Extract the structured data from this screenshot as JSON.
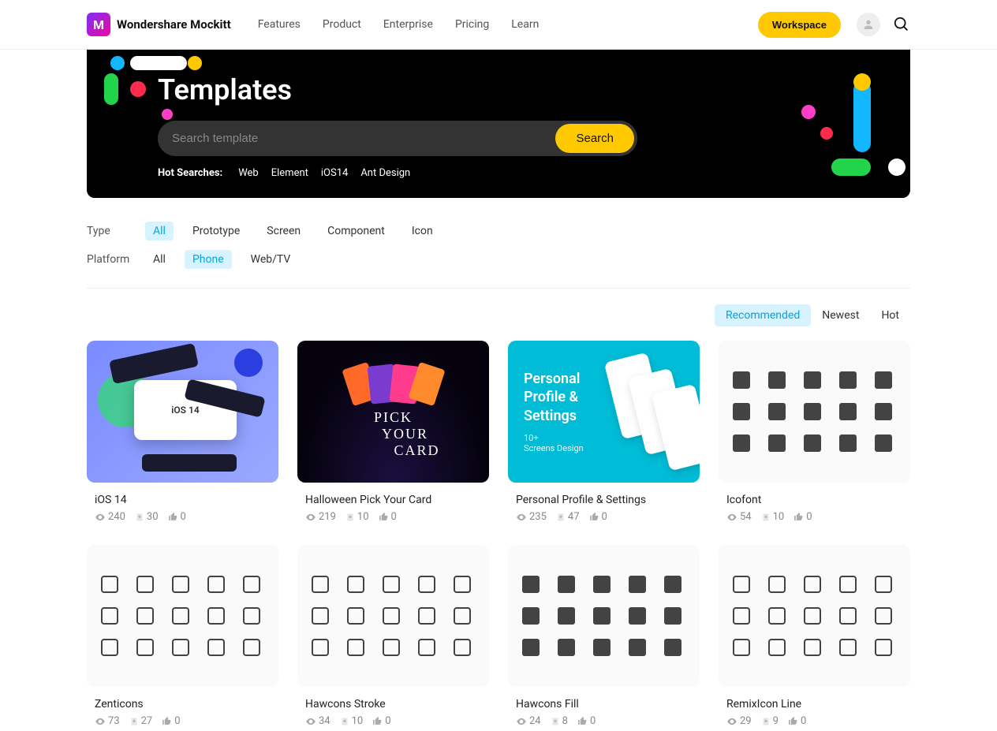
{
  "brand": "Wondershare Mockitt",
  "nav": [
    "Features",
    "Product",
    "Enterprise",
    "Pricing",
    "Learn"
  ],
  "workspace_btn": "Workspace",
  "hero": {
    "title": "Templates",
    "search_placeholder": "Search template",
    "search_btn": "Search",
    "hot_label": "Hot Searches:",
    "hot_tags": [
      "Web",
      "Element",
      "iOS14",
      "Ant Design"
    ]
  },
  "filters": {
    "type_label": "Type",
    "type_opts": [
      "All",
      "Prototype",
      "Screen",
      "Component",
      "Icon"
    ],
    "type_active": 0,
    "platform_label": "Platform",
    "platform_opts": [
      "All",
      "Phone",
      "Web/TV"
    ],
    "platform_active": 1
  },
  "sort": {
    "opts": [
      "Recommended",
      "Newest",
      "Hot"
    ],
    "active": 0
  },
  "cards": [
    {
      "title": "iOS 14",
      "views": "240",
      "downloads": "30",
      "likes": "0",
      "thumb": "ios14"
    },
    {
      "title": "Halloween Pick Your Card",
      "views": "219",
      "downloads": "10",
      "likes": "0",
      "thumb": "halloween"
    },
    {
      "title": "Personal Profile & Settings",
      "views": "235",
      "downloads": "47",
      "likes": "0",
      "thumb": "profile"
    },
    {
      "title": "Icofont",
      "views": "54",
      "downloads": "10",
      "likes": "0",
      "thumb": "icons-fill"
    },
    {
      "title": "Zenticons",
      "views": "73",
      "downloads": "27",
      "likes": "0",
      "thumb": "icons-line"
    },
    {
      "title": "Hawcons Stroke",
      "views": "34",
      "downloads": "10",
      "likes": "0",
      "thumb": "icons-line"
    },
    {
      "title": "Hawcons Fill",
      "views": "24",
      "downloads": "8",
      "likes": "0",
      "thumb": "icons-fill"
    },
    {
      "title": "RemixIcon Line",
      "views": "29",
      "downloads": "9",
      "likes": "0",
      "thumb": "icons-line"
    }
  ],
  "thumb_text": {
    "halloween": [
      "PICK",
      "YOUR",
      "CARD"
    ],
    "profile_title": "Personal\nProfile &\nSettings",
    "profile_sub": "10+\nScreens Design"
  }
}
